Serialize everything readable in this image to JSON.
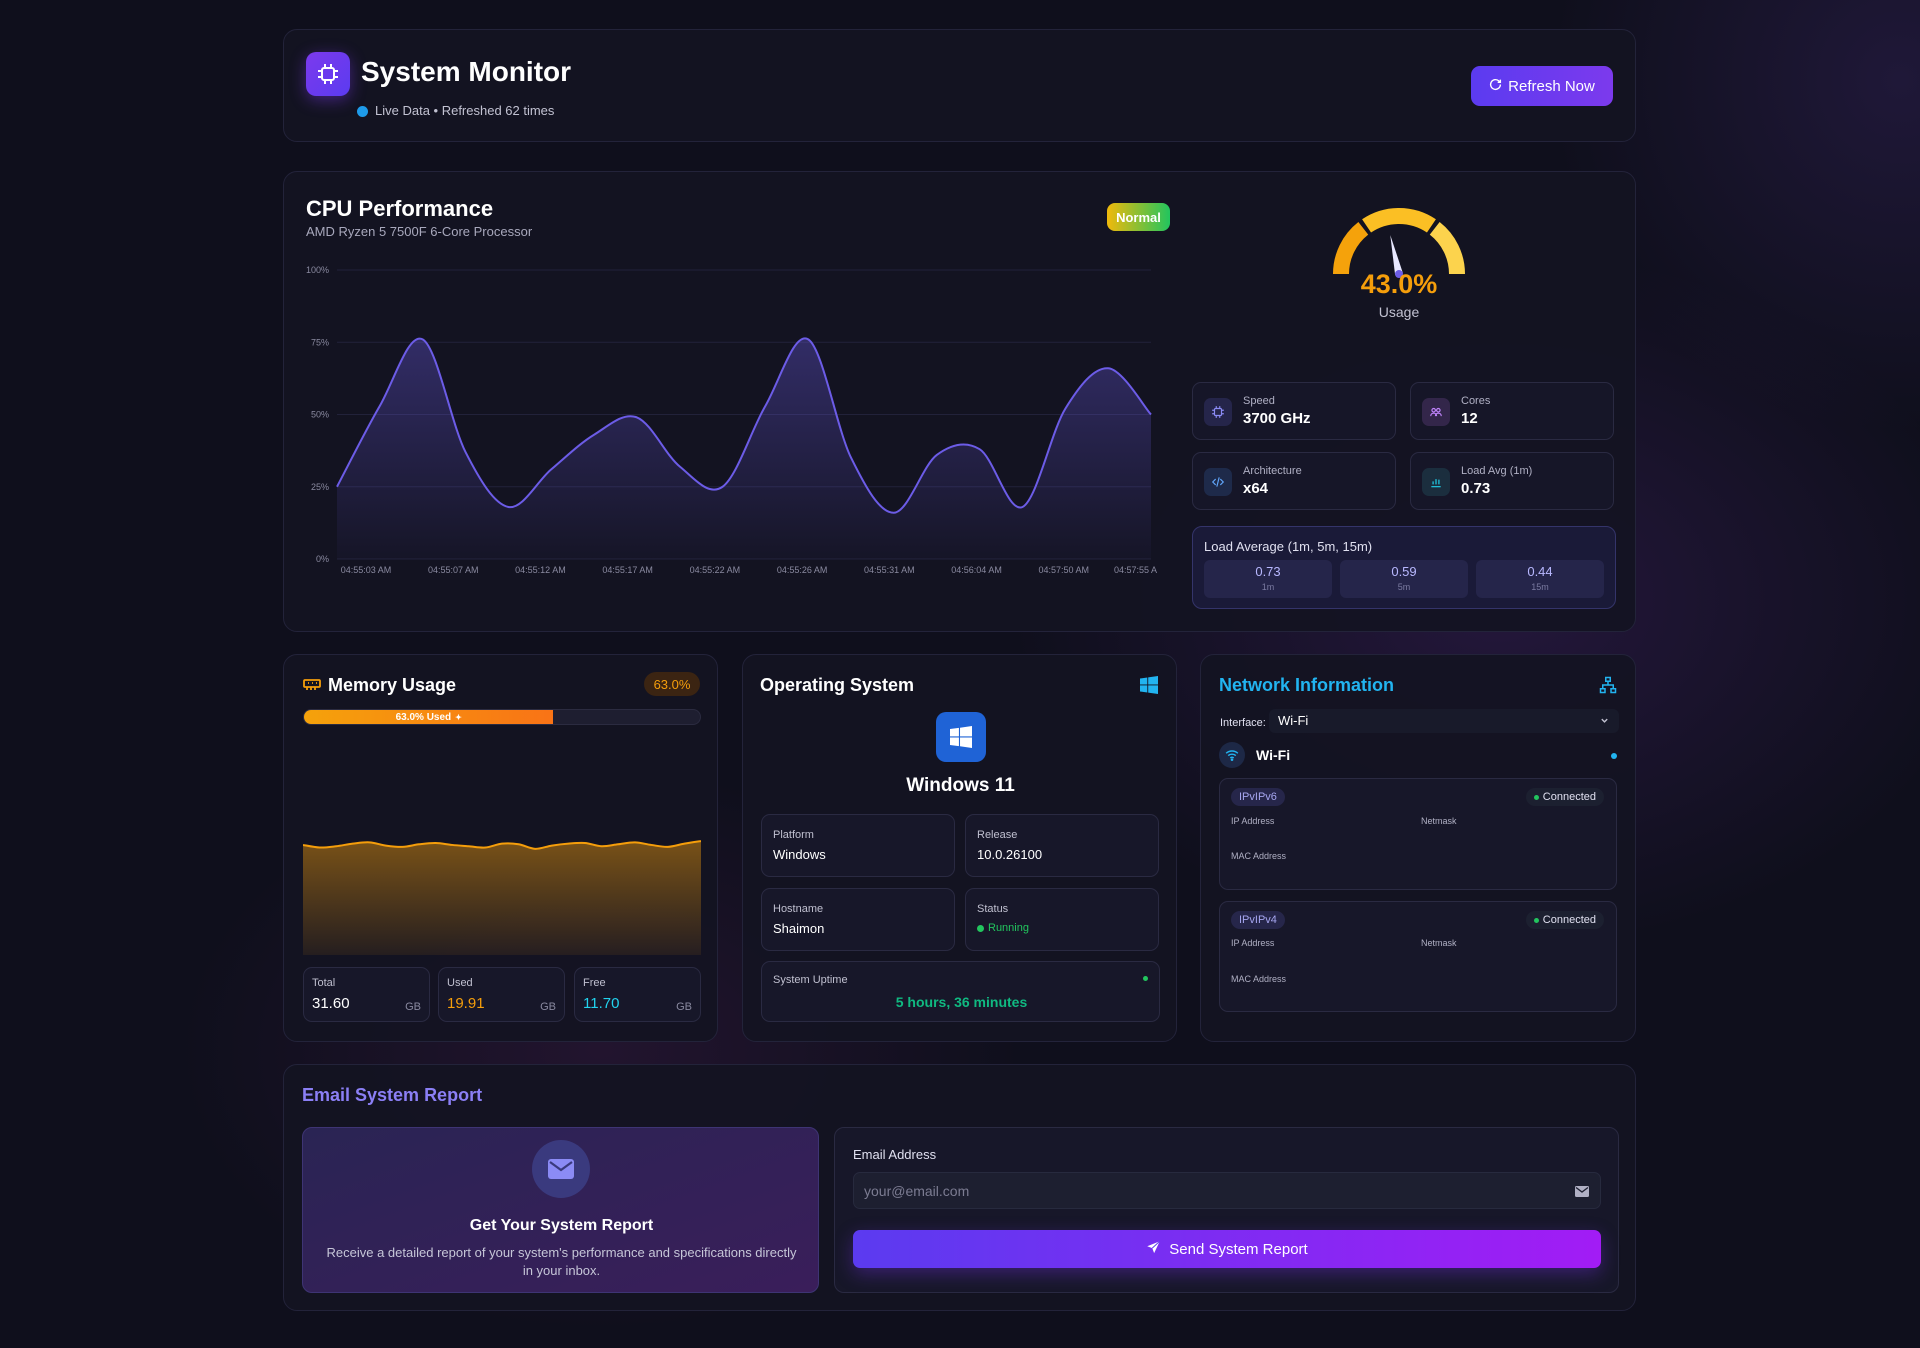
{
  "header": {
    "title": "System Monitor",
    "status_text": "Live Data • Refreshed 62 times",
    "refresh_label": "Refresh Now"
  },
  "cpu": {
    "title": "CPU Performance",
    "model": "AMD Ryzen 5 7500F 6-Core Processor",
    "status_badge": "Normal",
    "usage_value": "43.0%",
    "usage_percent": 43,
    "usage_label": "Usage",
    "stats": [
      {
        "label": "Speed",
        "value": "3700 GHz",
        "icon": "chip-icon"
      },
      {
        "label": "Cores",
        "value": "12",
        "icon": "cores-icon"
      },
      {
        "label": "Architecture",
        "value": "x64",
        "icon": "code-icon"
      },
      {
        "label": "Load Avg (1m)",
        "value": "0.73",
        "icon": "bar-chart-icon"
      }
    ],
    "load_average": {
      "title": "Load Average (1m, 5m, 15m)",
      "values": [
        {
          "value": "0.73",
          "label": "1m"
        },
        {
          "value": "0.59",
          "label": "5m"
        },
        {
          "value": "0.44",
          "label": "15m"
        }
      ]
    }
  },
  "chart_data": {
    "type": "area",
    "y_ticks": [
      "0%",
      "25%",
      "50%",
      "75%",
      "100%"
    ],
    "ylim": [
      0,
      100
    ],
    "x_tick_labels": [
      "04:55:03 AM",
      "04:55:07 AM",
      "04:55:12 AM",
      "04:55:17 AM",
      "04:55:22 AM",
      "04:55:26 AM",
      "04:55:31 AM",
      "04:56:04 AM",
      "04:57:50 AM",
      "04:57:55 A"
    ],
    "values": [
      25,
      53,
      76,
      37,
      18,
      31,
      43,
      49,
      32,
      25,
      53,
      76,
      35,
      16,
      36,
      38,
      18,
      52,
      66,
      50
    ],
    "color": "#6c5ce7"
  },
  "memory": {
    "title": "Memory Usage",
    "percent_badge": "63.0%",
    "bar_label": "63.0% Used",
    "used_fraction": 0.63,
    "history_values": [
      63.2,
      62.8,
      63.0,
      63.4,
      63.6,
      63.1,
      62.9,
      63.3,
      63.5,
      63.2,
      63.0,
      62.8,
      63.4,
      63.3,
      62.6,
      63.1,
      63.4,
      63.5,
      63.0,
      63.3,
      63.6,
      63.2,
      62.9,
      63.4,
      63.8
    ],
    "stats": [
      {
        "label": "Total",
        "value": "31.60",
        "unit": "GB",
        "color": "#ffffff"
      },
      {
        "label": "Used",
        "value": "19.91",
        "unit": "GB",
        "color": "#f59e0b"
      },
      {
        "label": "Free",
        "value": "11.70",
        "unit": "GB",
        "color": "#22d3ee"
      }
    ]
  },
  "os": {
    "title": "Operating System",
    "name": "Windows 11",
    "platform_label": "Platform",
    "platform_value": "Windows",
    "release_label": "Release",
    "release_value": "10.0.26100",
    "hostname_label": "Hostname",
    "hostname_value": "Shaimon",
    "status_label": "Status",
    "status_value": "Running",
    "uptime_label": "System Uptime",
    "uptime_value": "5 hours, 36 minutes"
  },
  "network": {
    "title": "Network Information",
    "interface_label": "Interface:",
    "interface_value": "Wi-Fi",
    "adapter_name": "Wi-Fi",
    "addresses": [
      {
        "family": "IPvIPv6",
        "status": "Connected",
        "ip_label": "IP Address",
        "netmask_label": "Netmask",
        "mac_label": "MAC Address"
      },
      {
        "family": "IPvIPv4",
        "status": "Connected",
        "ip_label": "IP Address",
        "netmask_label": "Netmask",
        "mac_label": "MAC Address"
      }
    ]
  },
  "email": {
    "title": "Email System Report",
    "promo_title": "Get Your System Report",
    "promo_desc": "Receive a detailed report of your system's performance and specifications directly in your inbox.",
    "field_label": "Email Address",
    "placeholder": "your@email.com",
    "send_label": "Send System Report"
  },
  "colors": {
    "accent": "#6c5ce7",
    "warning": "#f59e0b",
    "success": "#22c55e",
    "info": "#22d3ee"
  }
}
